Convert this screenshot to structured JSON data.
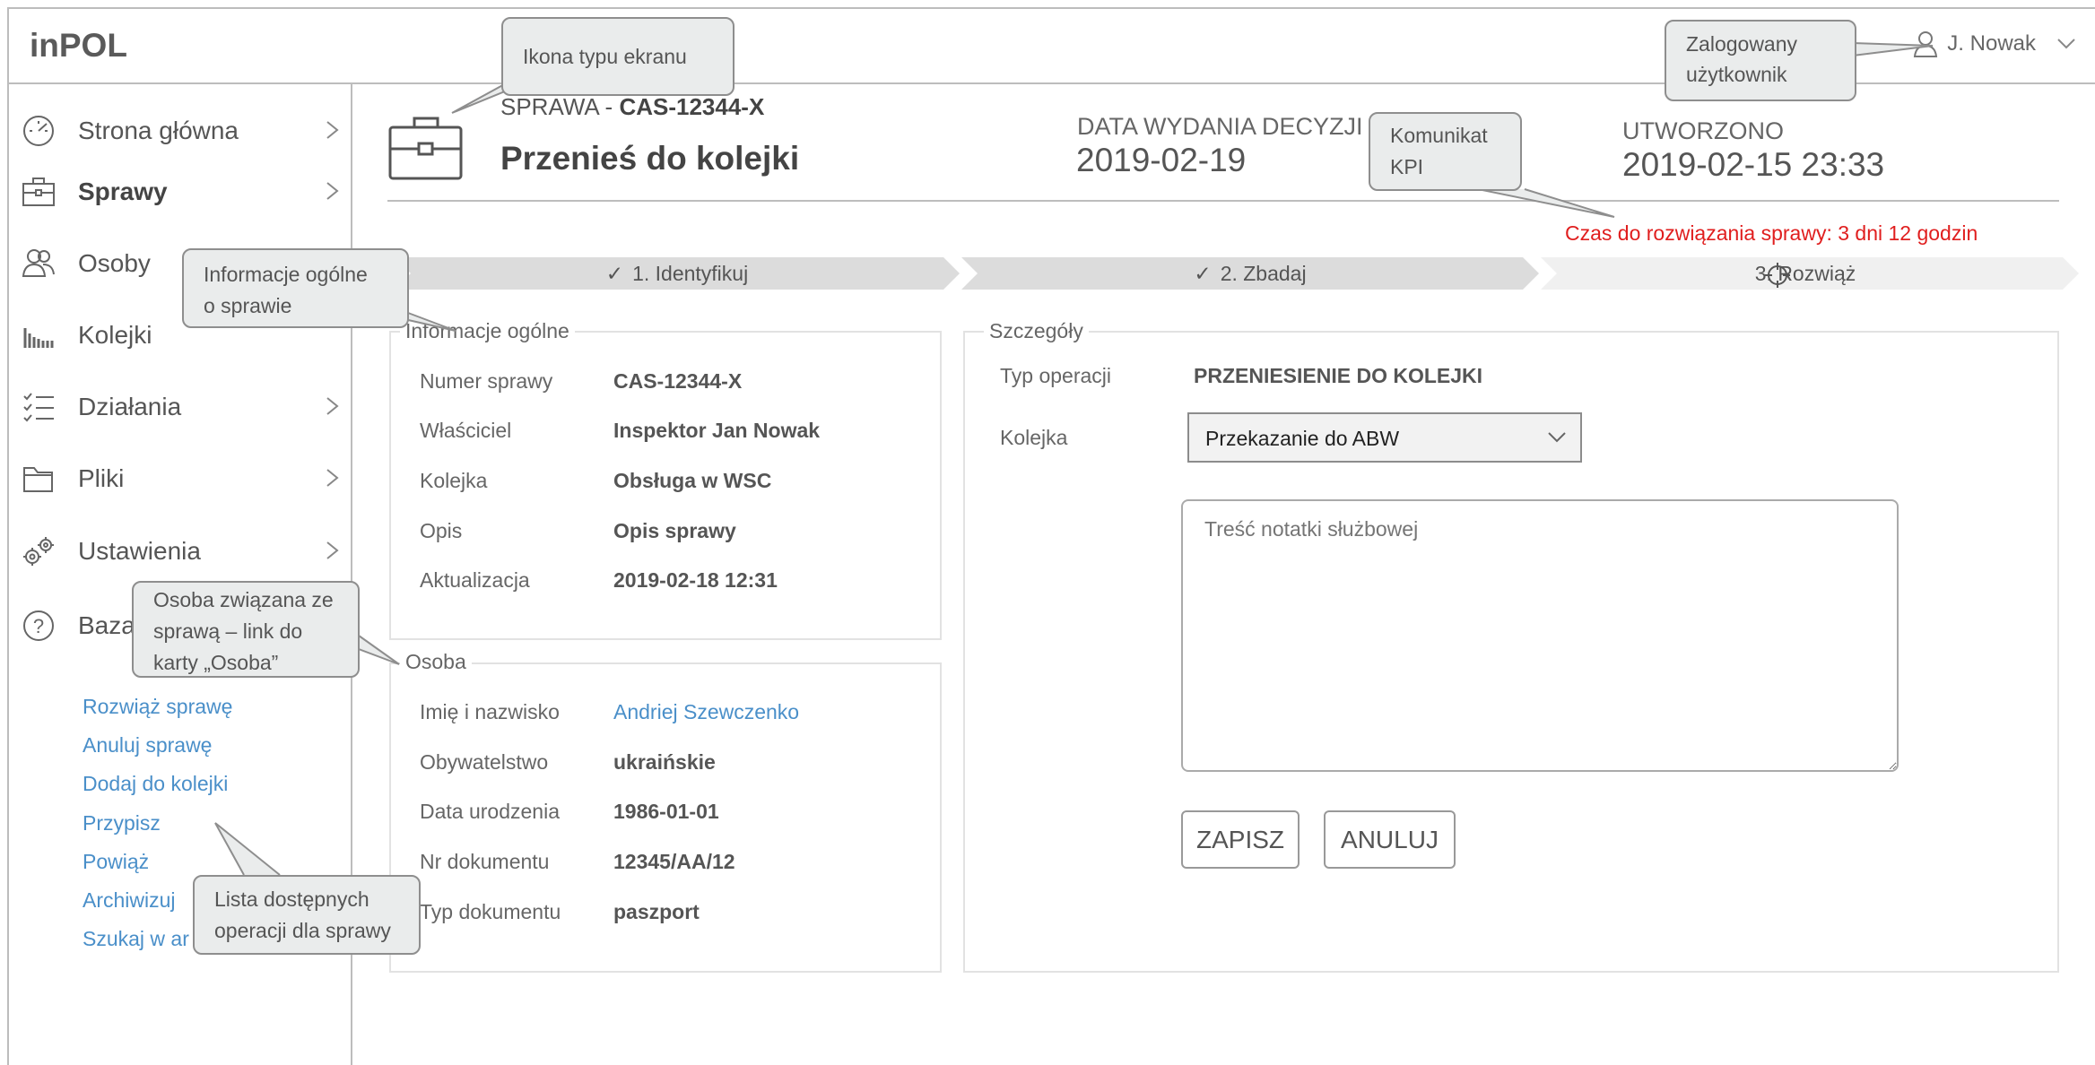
{
  "app": {
    "title": "inPOL"
  },
  "user": {
    "name": "J. Nowak"
  },
  "sidebar": {
    "items": [
      {
        "label": "Strona główna",
        "icon": "dashboard-icon",
        "bold": false
      },
      {
        "label": "Sprawy",
        "icon": "briefcase-icon",
        "bold": true
      },
      {
        "label": "Osoby",
        "icon": "people-icon",
        "bold": false
      },
      {
        "label": "Kolejki",
        "icon": "queue-icon",
        "bold": false
      },
      {
        "label": "Działania",
        "icon": "checklist-icon",
        "bold": false
      },
      {
        "label": "Pliki",
        "icon": "folder-icon",
        "bold": false
      },
      {
        "label": "Ustawienia",
        "icon": "gears-icon",
        "bold": false
      },
      {
        "label": "Baza",
        "icon": "help-icon",
        "bold": false
      }
    ],
    "operations": [
      "Rozwiąż sprawę",
      "Anuluj sprawę",
      "Dodaj do kolejki",
      "Przypisz",
      "Powiąż",
      "Archiwizuj",
      "Szukaj w ar"
    ]
  },
  "case": {
    "prefix": "SPRAWA - ",
    "id": "CAS-12344-X",
    "title": "Przenieś do kolejki",
    "decision_date_label": "DATA WYDANIA DECYZJI",
    "decision_date": "2019-02-19",
    "created_label": "UTWORZONO",
    "created": "2019-02-15 23:33",
    "kpi_text": "Czas do rozwiązania sprawy:  3 dni 12 godzin"
  },
  "steps": [
    {
      "label": "1. Identyfikuj",
      "state": "done"
    },
    {
      "label": "2. Zbadaj",
      "state": "done"
    },
    {
      "label": "3. Rozwiąż",
      "state": "active"
    }
  ],
  "general_info": {
    "legend": "Informacje ogólne",
    "rows": [
      {
        "label": "Numer sprawy",
        "value": "CAS-12344-X"
      },
      {
        "label": "Właściciel",
        "value": "Inspektor Jan Nowak"
      },
      {
        "label": "Kolejka",
        "value": "Obsługa w WSC"
      },
      {
        "label": "Opis",
        "value": "Opis sprawy"
      },
      {
        "label": "Aktualizacja",
        "value": "2019-02-18 12:31"
      }
    ]
  },
  "person": {
    "legend": "Osoba",
    "name_label": "Imię i nazwisko",
    "name": "Andriej Szewczenko",
    "rows": [
      {
        "label": "Obywatelstwo",
        "value": "ukraińskie"
      },
      {
        "label": "Data urodzenia",
        "value": "1986-01-01"
      },
      {
        "label": "Nr dokumentu",
        "value": "12345/AA/12"
      },
      {
        "label": "Typ dokumentu",
        "value": "paszport"
      }
    ]
  },
  "details": {
    "legend": "Szczegóły",
    "op_type_label": "Typ operacji",
    "op_type": "PRZENIESIENIE DO KOLEJKI",
    "queue_label": "Kolejka",
    "queue_value": "Przekazanie do ABW",
    "note_placeholder": "Treść notatki służbowej",
    "save_label": "ZAPISZ",
    "cancel_label": "ANULUJ"
  },
  "callouts": {
    "screen_icon": "Ikona typu ekranu",
    "logged_user_1": "Zalogowany",
    "logged_user_2": "użytkownik",
    "kpi": "Komunikat KPI",
    "general_1": "Informacje ogólne",
    "general_2": "o sprawie",
    "person_1": "Osoba związana ze",
    "person_2": "sprawą – link do",
    "person_3": "karty „Osoba”",
    "ops_1": "Lista dostępnych",
    "ops_2": "operacji dla sprawy"
  },
  "colors": {
    "link": "#4a8fc9",
    "kpi": "#e01e1e",
    "callout_bg": "#eaecec"
  }
}
